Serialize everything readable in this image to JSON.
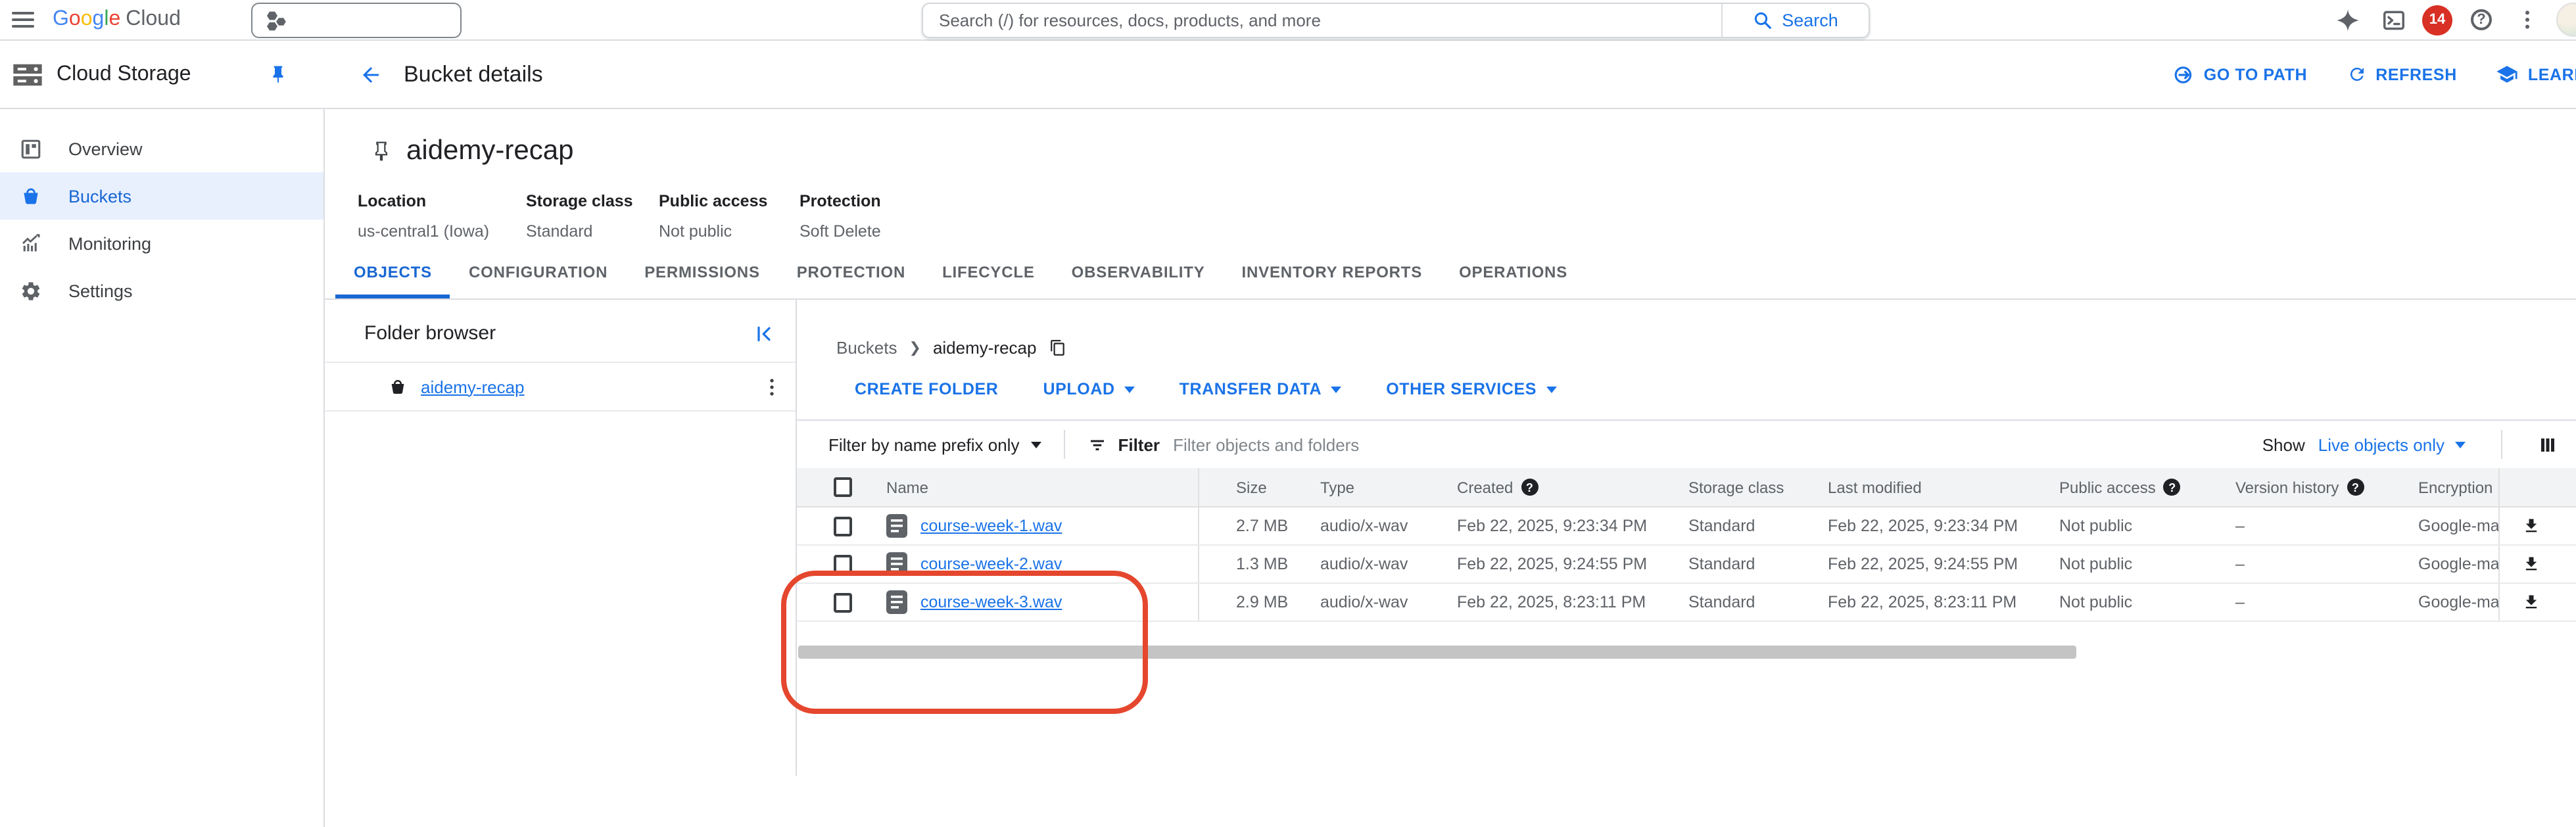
{
  "colors": {
    "accent_blue": "#1a73e8",
    "active_blue": "#1967d2",
    "annotation_red": "#e5472e",
    "badge_red": "#d93025"
  },
  "topbar": {
    "logo": {
      "letters": [
        {
          "ch": "G"
        },
        {
          "ch": "o"
        },
        {
          "ch": "o"
        },
        {
          "ch": "g"
        },
        {
          "ch": "l"
        },
        {
          "ch": "e"
        }
      ],
      "suffix": "Cloud"
    },
    "search": {
      "placeholder": "Search (/) for resources, docs, products, and more",
      "button_label": "Search"
    },
    "notifications_count": "14"
  },
  "app_header": {
    "product_name": "Cloud Storage",
    "page_title": "Bucket details",
    "actions": {
      "go_to_path": "GO TO PATH",
      "refresh": "REFRESH",
      "learn": "LEARN"
    }
  },
  "sidebar": {
    "items": [
      {
        "label": "Overview"
      },
      {
        "label": "Buckets"
      },
      {
        "label": "Monitoring"
      },
      {
        "label": "Settings"
      }
    ]
  },
  "bucket": {
    "name": "aidemy-recap",
    "meta": [
      {
        "label": "Location",
        "value": "us-central1 (Iowa)"
      },
      {
        "label": "Storage class",
        "value": "Standard"
      },
      {
        "label": "Public access",
        "value": "Not public"
      },
      {
        "label": "Protection",
        "value": "Soft Delete"
      }
    ]
  },
  "tabs": [
    "OBJECTS",
    "CONFIGURATION",
    "PERMISSIONS",
    "PROTECTION",
    "LIFECYCLE",
    "OBSERVABILITY",
    "INVENTORY REPORTS",
    "OPERATIONS"
  ],
  "folder_browser": {
    "title": "Folder browser",
    "bucket_link": "aidemy-recap"
  },
  "objects": {
    "breadcrumb": {
      "root": "Buckets",
      "separator": "❯",
      "current": "aidemy-recap"
    },
    "toolbar": {
      "create_folder": "CREATE FOLDER",
      "upload": "UPLOAD",
      "transfer_data": "TRANSFER DATA",
      "other_services": "OTHER SERVICES"
    },
    "filter": {
      "prefix_dropdown": "Filter by name prefix only",
      "label": "Filter",
      "placeholder": "Filter objects and folders",
      "show_label": "Show",
      "show_value": "Live objects only"
    },
    "table": {
      "columns": [
        "Name",
        "Size",
        "Type",
        "Created",
        "Storage class",
        "Last modified",
        "Public access",
        "Version history",
        "Encryption"
      ],
      "rows": [
        {
          "name": "course-week-1.wav",
          "size": "2.7 MB",
          "type": "audio/x-wav",
          "created": "Feb 22, 2025, 9:23:34 PM",
          "storage_class": "Standard",
          "last_modified": "Feb 22, 2025, 9:23:34 PM",
          "public_access": "Not public",
          "version_history": "–",
          "encryption": "Google-mana"
        },
        {
          "name": "course-week-2.wav",
          "size": "1.3 MB",
          "type": "audio/x-wav",
          "created": "Feb 22, 2025, 9:24:55 PM",
          "storage_class": "Standard",
          "last_modified": "Feb 22, 2025, 9:24:55 PM",
          "public_access": "Not public",
          "version_history": "–",
          "encryption": "Google-mana"
        },
        {
          "name": "course-week-3.wav",
          "size": "2.9 MB",
          "type": "audio/x-wav",
          "created": "Feb 22, 2025, 8:23:11 PM",
          "storage_class": "Standard",
          "last_modified": "Feb 22, 2025, 8:23:11 PM",
          "public_access": "Not public",
          "version_history": "–",
          "encryption": "Google-mana"
        }
      ]
    }
  }
}
